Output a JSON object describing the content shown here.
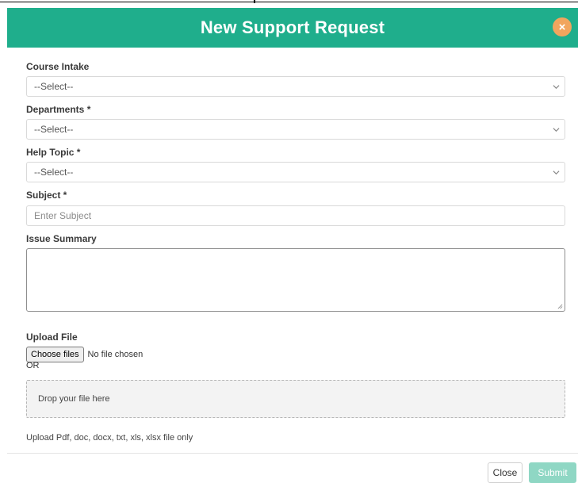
{
  "modal": {
    "title": "New Support Request",
    "close_icon_glyph": "×"
  },
  "fields": {
    "course_intake": {
      "label": "Course Intake",
      "value": "--Select--"
    },
    "departments": {
      "label": "Departments *",
      "value": "--Select--"
    },
    "help_topic": {
      "label": "Help Topic *",
      "value": "--Select--"
    },
    "subject": {
      "label": "Subject *",
      "placeholder": "Enter Subject"
    },
    "issue_summary": {
      "label": "Issue Summary",
      "value": ""
    }
  },
  "upload": {
    "label": "Upload File",
    "button_label": "Choose files",
    "status": "No file chosen",
    "or_text": "OR",
    "dropzone_text": "Drop your file here",
    "note": "Upload Pdf, doc, docx, txt, xls, xlsx file only"
  },
  "footer": {
    "close_label": "Close",
    "submit_label": "Submit"
  },
  "colors": {
    "header_bg": "#1fae8c",
    "close_icon_bg": "#f1a55e",
    "submit_bg": "#8fd7c4"
  },
  "icons": {
    "close": "close-icon",
    "chevron": "chevron-down-icon",
    "resize": "resize-grip-icon"
  }
}
